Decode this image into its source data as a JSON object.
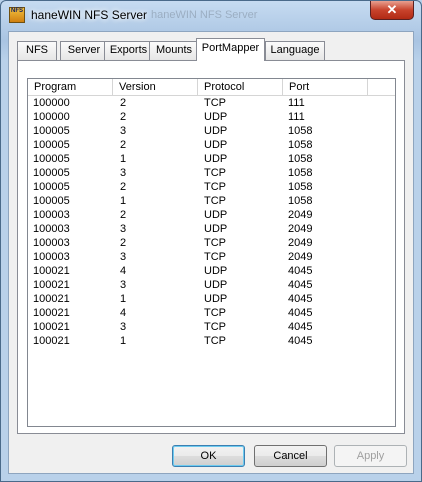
{
  "window": {
    "title": "haneWIN NFS Server",
    "ghost_title": "haneWIN NFS Server",
    "icon_text": "NFS",
    "close_label": "✕"
  },
  "tabs": [
    {
      "label": "NFS"
    },
    {
      "label": "Server"
    },
    {
      "label": "Exports"
    },
    {
      "label": "Mounts"
    },
    {
      "label": "PortMapper"
    },
    {
      "label": "Language"
    }
  ],
  "active_tab": "PortMapper",
  "table": {
    "columns": [
      "Program",
      "Version",
      "Protocol",
      "Port"
    ],
    "rows": [
      [
        "100000",
        "2",
        "TCP",
        "111"
      ],
      [
        "100000",
        "2",
        "UDP",
        "111"
      ],
      [
        "100005",
        "3",
        "UDP",
        "1058"
      ],
      [
        "100005",
        "2",
        "UDP",
        "1058"
      ],
      [
        "100005",
        "1",
        "UDP",
        "1058"
      ],
      [
        "100005",
        "3",
        "TCP",
        "1058"
      ],
      [
        "100005",
        "2",
        "TCP",
        "1058"
      ],
      [
        "100005",
        "1",
        "TCP",
        "1058"
      ],
      [
        "100003",
        "2",
        "UDP",
        "2049"
      ],
      [
        "100003",
        "3",
        "UDP",
        "2049"
      ],
      [
        "100003",
        "2",
        "TCP",
        "2049"
      ],
      [
        "100003",
        "3",
        "TCP",
        "2049"
      ],
      [
        "100021",
        "4",
        "UDP",
        "4045"
      ],
      [
        "100021",
        "3",
        "UDP",
        "4045"
      ],
      [
        "100021",
        "1",
        "UDP",
        "4045"
      ],
      [
        "100021",
        "4",
        "TCP",
        "4045"
      ],
      [
        "100021",
        "3",
        "TCP",
        "4045"
      ],
      [
        "100021",
        "1",
        "TCP",
        "4045"
      ]
    ]
  },
  "buttons": {
    "ok": "OK",
    "cancel": "Cancel",
    "apply": "Apply"
  }
}
